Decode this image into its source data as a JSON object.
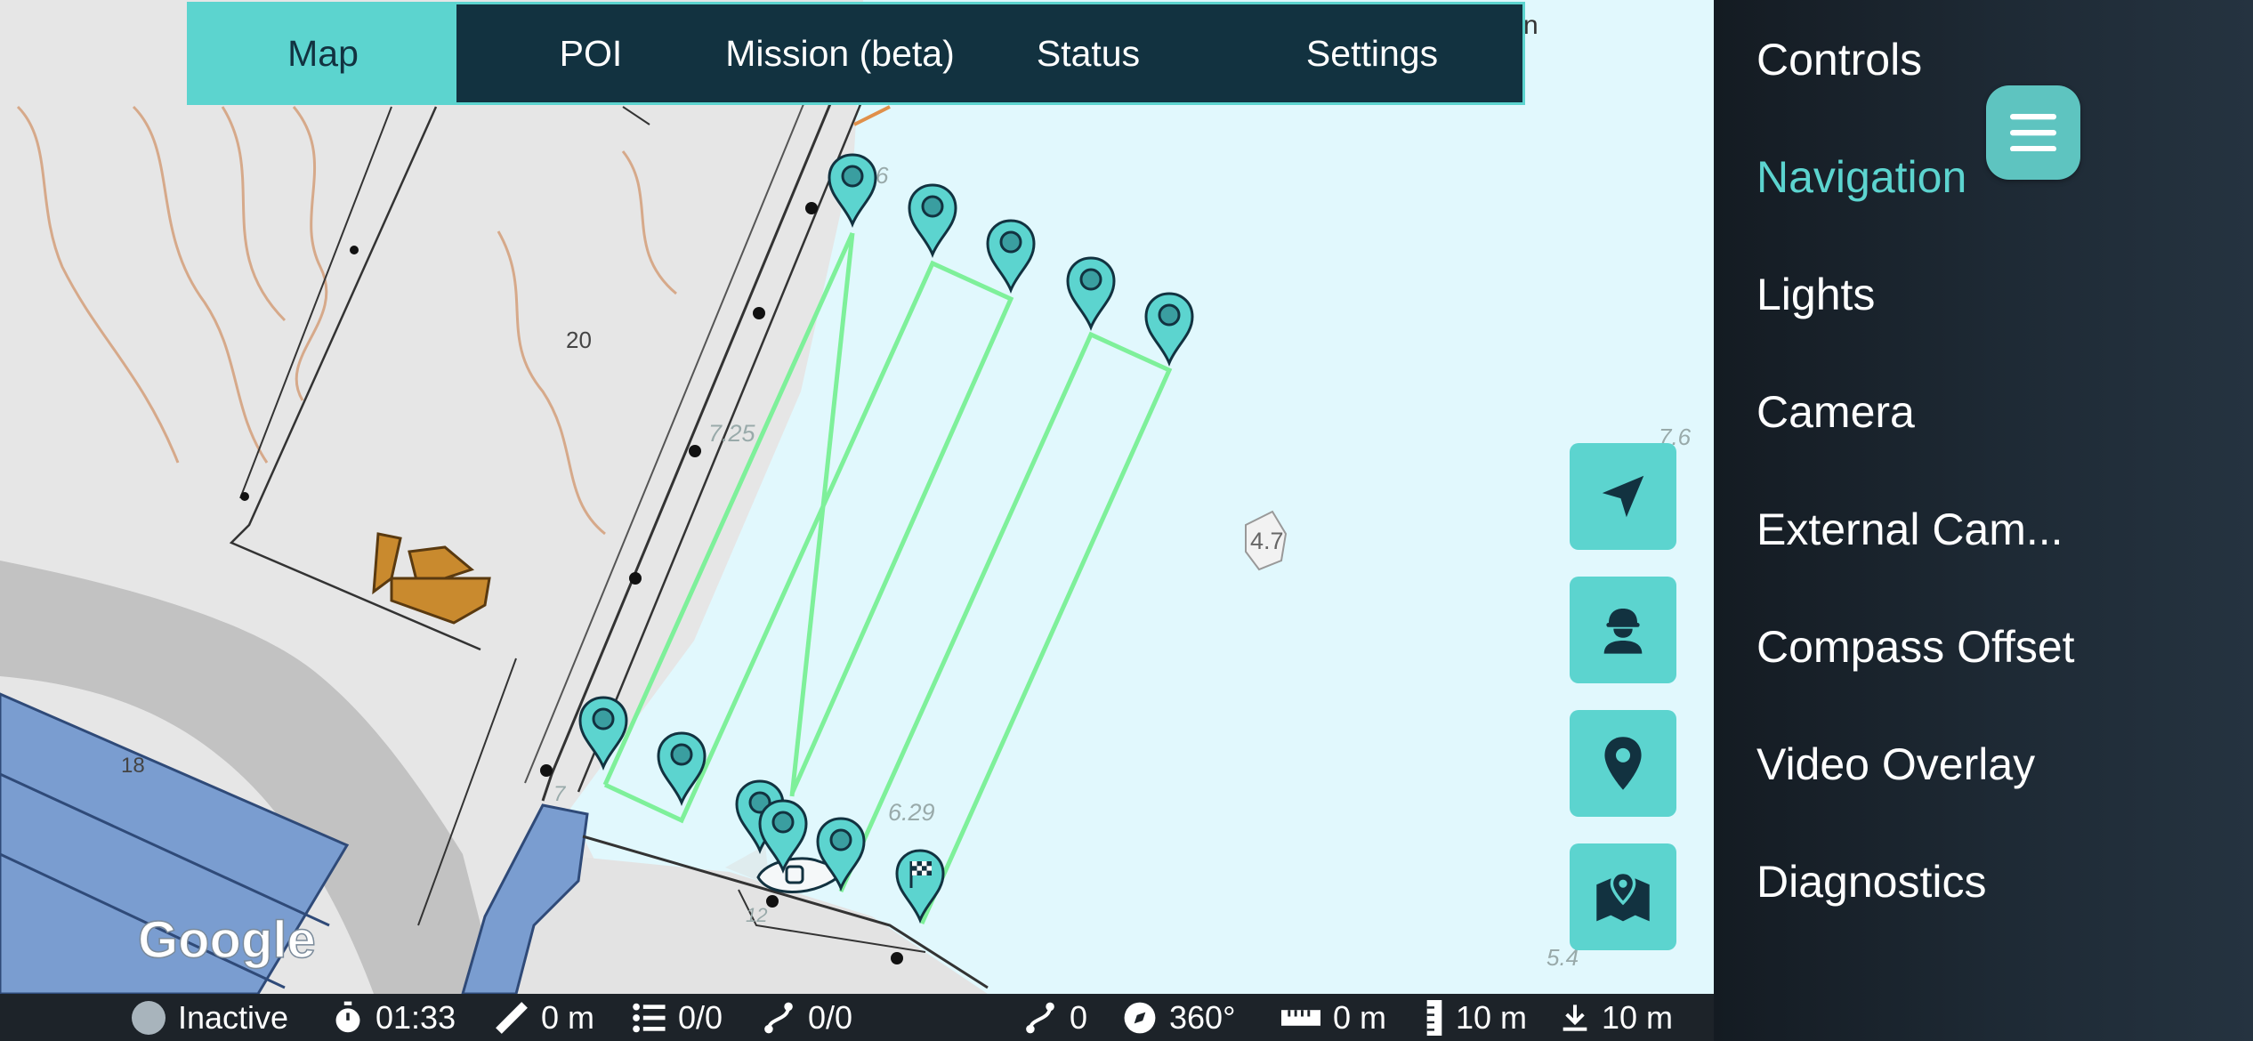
{
  "tabs": [
    {
      "label": "Map",
      "active": true
    },
    {
      "label": "POI",
      "active": false
    },
    {
      "label": "Mission (beta)",
      "active": false
    },
    {
      "label": "Status",
      "active": false
    },
    {
      "label": "Settings",
      "active": false
    }
  ],
  "map": {
    "provider_logo": "Google",
    "depth_labels": [
      "20",
      "18",
      "7.25",
      "6.29",
      "4.7",
      "7.6",
      "5.4",
      "6",
      "7",
      "12"
    ],
    "tile_fragment": "n",
    "colors": {
      "water": "#e1f8fd",
      "land": "#e8e8e8",
      "path": "#7ef09a",
      "marker": "#5cd4cf",
      "marker_dark": "#123240"
    }
  },
  "map_buttons": [
    {
      "icon": "navigation-arrow-icon"
    },
    {
      "icon": "worker-icon"
    },
    {
      "icon": "location-pin-icon"
    },
    {
      "icon": "map-pin-icon"
    }
  ],
  "status_bar": {
    "connection_status": "Inactive",
    "timer": "01:33",
    "distance": "0 m",
    "waypoint_progress": "0/0",
    "route_progress": "0/0",
    "route_count": "0",
    "heading": "360°",
    "range": "0 m",
    "depth": "10 m",
    "altitude": "10 m"
  },
  "side_menu": {
    "items": [
      {
        "label": "Controls",
        "active": false
      },
      {
        "label": "Navigation",
        "active": true
      },
      {
        "label": "Lights",
        "active": false
      },
      {
        "label": "Camera",
        "active": false
      },
      {
        "label": "External Cam...",
        "active": false
      },
      {
        "label": "Compass Offset",
        "active": false
      },
      {
        "label": "Video Overlay",
        "active": false
      },
      {
        "label": "Diagnostics",
        "active": false
      }
    ],
    "accent": "#5cd4cf"
  }
}
